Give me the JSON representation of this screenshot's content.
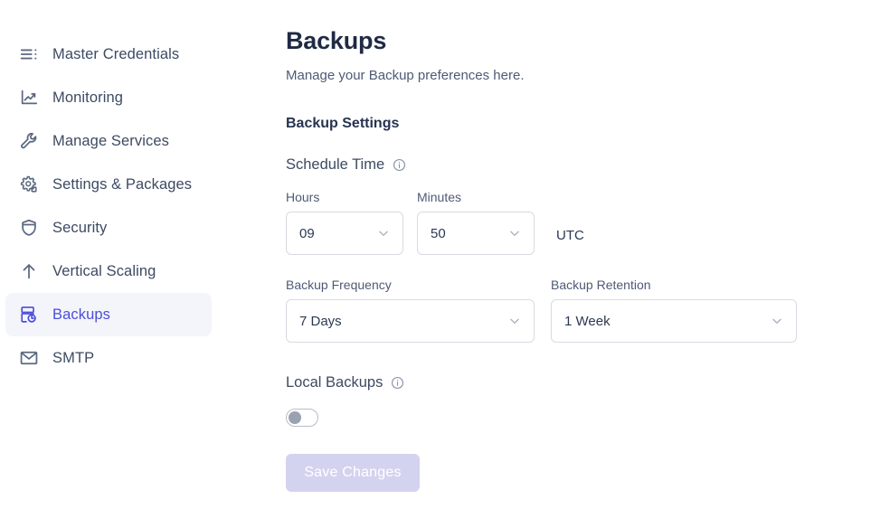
{
  "sidebar": {
    "items": [
      {
        "label": "Master Credentials",
        "icon": "list-icon",
        "active": false
      },
      {
        "label": "Monitoring",
        "icon": "chart-line-icon",
        "active": false
      },
      {
        "label": "Manage Services",
        "icon": "wrench-icon",
        "active": false
      },
      {
        "label": "Settings & Packages",
        "icon": "gear-icon",
        "active": false
      },
      {
        "label": "Security",
        "icon": "shield-icon",
        "active": false
      },
      {
        "label": "Vertical Scaling",
        "icon": "arrow-up-icon",
        "active": false
      },
      {
        "label": "Backups",
        "icon": "database-refresh-icon",
        "active": true
      },
      {
        "label": "SMTP",
        "icon": "envelope-icon",
        "active": false
      }
    ]
  },
  "main": {
    "title": "Backups",
    "subtitle": "Manage your Backup preferences here.",
    "section_title": "Backup Settings",
    "schedule_time": {
      "heading": "Schedule Time",
      "info_icon": "info-circle-icon",
      "hours_label": "Hours",
      "hours_value": "09",
      "minutes_label": "Minutes",
      "minutes_value": "50",
      "timezone": "UTC"
    },
    "backup_frequency": {
      "label": "Backup Frequency",
      "value": "7 Days"
    },
    "backup_retention": {
      "label": "Backup Retention",
      "value": "1 Week"
    },
    "local_backups": {
      "heading": "Local Backups",
      "info_icon": "info-circle-icon",
      "enabled": false
    },
    "save_label": "Save Changes"
  },
  "colors": {
    "accent": "#4b4ddb",
    "active_bg": "#f4f5fb",
    "text_dark": "#1f2a44",
    "text_muted": "#4e5a76",
    "border": "#d9dbe2",
    "save_bg": "#d3d3f0"
  }
}
